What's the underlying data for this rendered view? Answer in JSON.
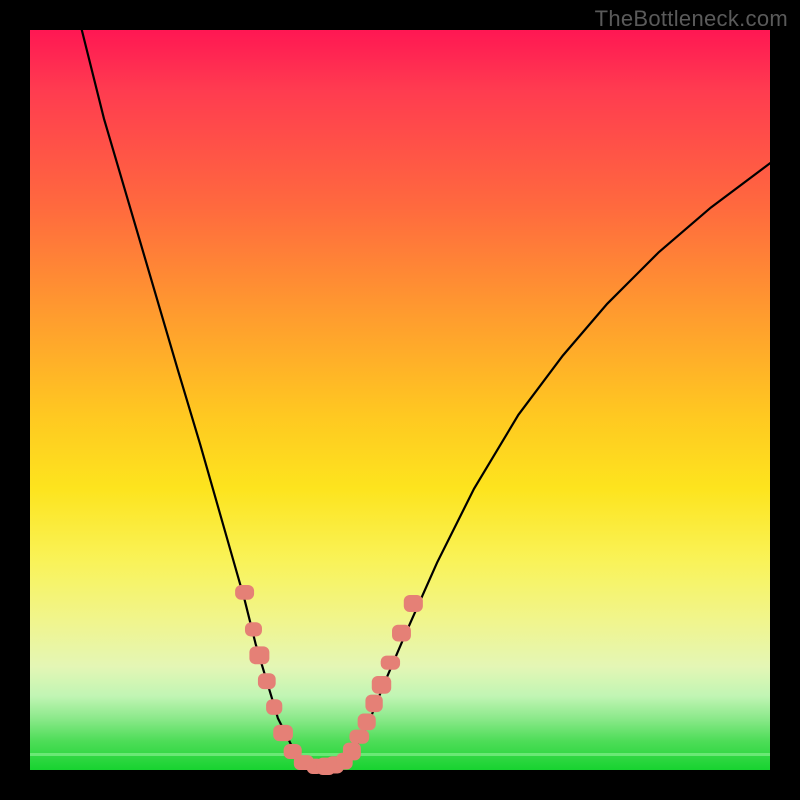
{
  "watermark": "TheBottleneck.com",
  "colors": {
    "frame": "#000000",
    "curve": "#000000",
    "marker": "#e58076",
    "gradient_top": "#ff1753",
    "gradient_bottom": "#17d330"
  },
  "chart_data": {
    "type": "line",
    "title": "",
    "xlabel": "",
    "ylabel": "",
    "xlim": [
      0,
      100
    ],
    "ylim": [
      0,
      100
    ],
    "grid": false,
    "legend": false,
    "series": [
      {
        "name": "left-branch",
        "x": [
          7,
          10,
          15,
          20,
          23,
          25,
          27,
          29,
          30.5,
          32,
          33.5,
          35,
          36.2,
          37
        ],
        "values": [
          100,
          88,
          71,
          54,
          44,
          37,
          30,
          23,
          17,
          12,
          7,
          4,
          1.5,
          0.5
        ]
      },
      {
        "name": "valley",
        "x": [
          37,
          38,
          39,
          40,
          41,
          42
        ],
        "values": [
          0.5,
          0.2,
          0.1,
          0.1,
          0.2,
          0.5
        ]
      },
      {
        "name": "right-branch",
        "x": [
          42,
          44,
          46,
          48,
          51,
          55,
          60,
          66,
          72,
          78,
          85,
          92,
          100
        ],
        "values": [
          0.5,
          3,
          7,
          12,
          19,
          28,
          38,
          48,
          56,
          63,
          70,
          76,
          82
        ]
      }
    ],
    "markers": [
      {
        "name": "left-cluster",
        "points": [
          {
            "x": 29.0,
            "y": 24.0
          },
          {
            "x": 30.2,
            "y": 19.0
          },
          {
            "x": 31.0,
            "y": 15.5
          },
          {
            "x": 32.0,
            "y": 12.0
          },
          {
            "x": 33.0,
            "y": 8.5
          },
          {
            "x": 34.2,
            "y": 5.0
          },
          {
            "x": 35.5,
            "y": 2.5
          },
          {
            "x": 37.0,
            "y": 1.0
          },
          {
            "x": 38.5,
            "y": 0.5
          },
          {
            "x": 40.0,
            "y": 0.5
          },
          {
            "x": 41.2,
            "y": 0.7
          }
        ]
      },
      {
        "name": "right-cluster",
        "points": [
          {
            "x": 42.5,
            "y": 1.2
          },
          {
            "x": 43.5,
            "y": 2.5
          },
          {
            "x": 44.5,
            "y": 4.5
          },
          {
            "x": 45.5,
            "y": 6.5
          },
          {
            "x": 46.5,
            "y": 9.0
          },
          {
            "x": 47.5,
            "y": 11.5
          },
          {
            "x": 48.7,
            "y": 14.5
          },
          {
            "x": 50.2,
            "y": 18.5
          },
          {
            "x": 51.8,
            "y": 22.5
          }
        ]
      }
    ]
  }
}
